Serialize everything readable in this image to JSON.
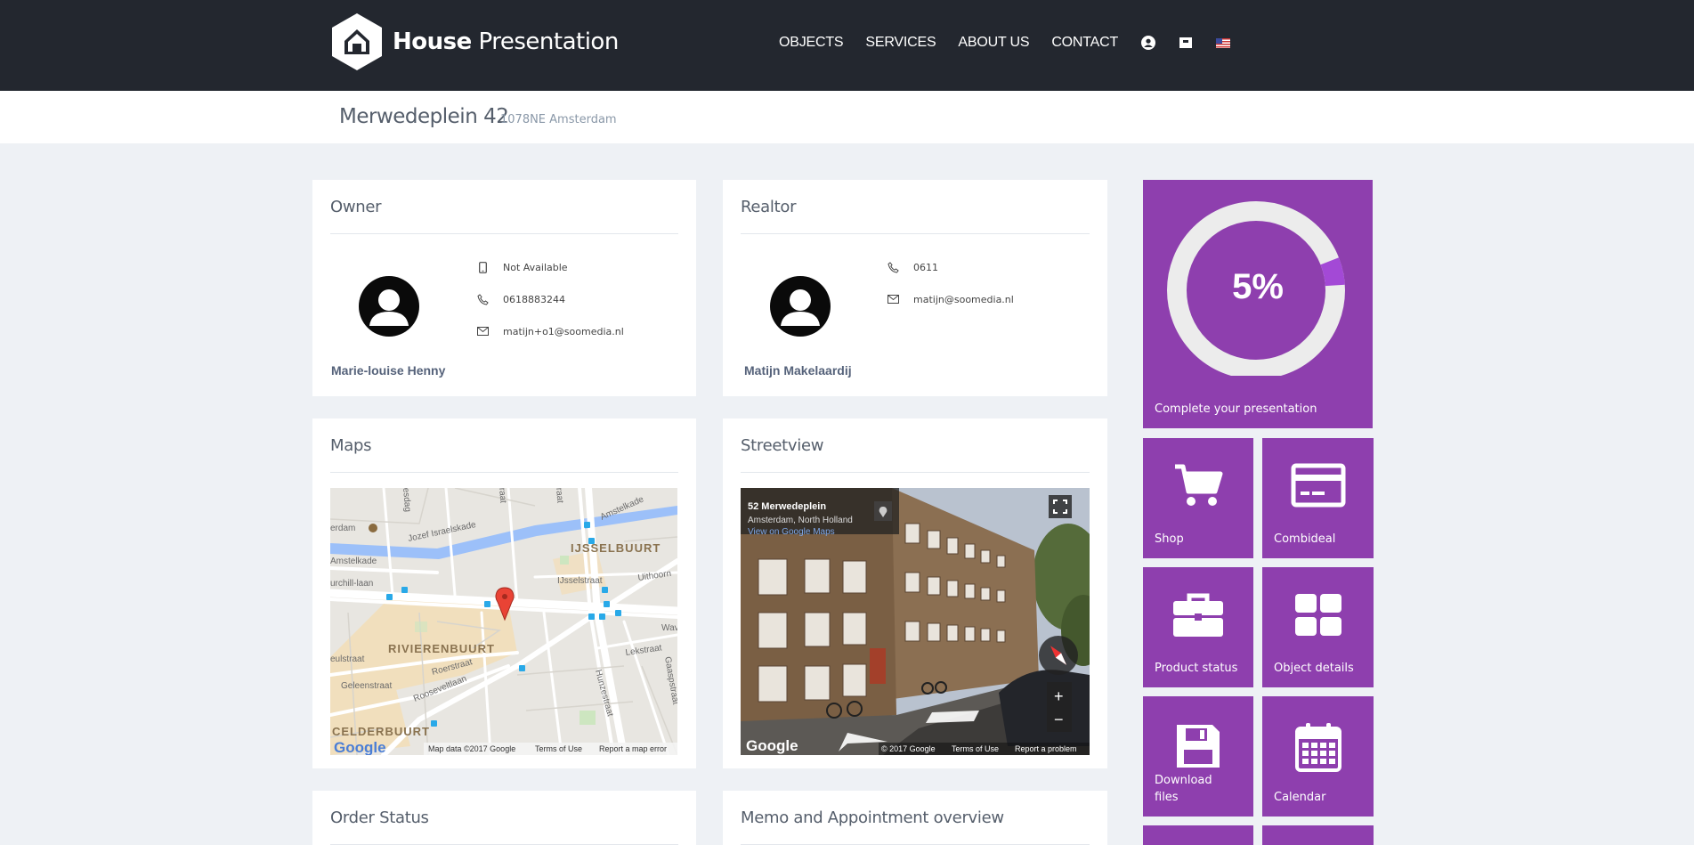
{
  "brand": {
    "bold": "House",
    "light": "Presentation"
  },
  "nav": {
    "items": [
      "OBJECTS",
      "SERVICES",
      "ABOUT US",
      "CONTACT"
    ]
  },
  "address": {
    "street": "Merwedeplein 42",
    "city": "1078NE Amsterdam"
  },
  "owner": {
    "title": "Owner",
    "name": "Marie-louise Henny",
    "mobile": "Not Available",
    "phone": "0618883244",
    "email": "matijn+o1@soomedia.nl"
  },
  "realtor": {
    "title": "Realtor",
    "name": "Matijn Makelaardij",
    "phone": "0611",
    "email": "matijn@soomedia.nl"
  },
  "maps": {
    "title": "Maps",
    "labels": {
      "ijsselbuurt": "IJSSELBUURT",
      "rivierenbuurt": "RIVIERENBUURT",
      "amstelkade_top": "Amstelkade",
      "amstelkade_left": "Amstelkade",
      "jozef": "Jozef Israelskade",
      "ijsselstraat": "IJsselstraat",
      "churchill": "urchill-laan",
      "rooseveltlaan": "Rooseveltlaan",
      "geleenstraat": "Geleenstraat",
      "roerstraat": "Roerstraat",
      "hunzestraat": "Hunzestraat",
      "lekstraat": "Lekstraat",
      "gaasp": "Gaaspstraat",
      "uithoorn": "Uithoorn",
      "waver": "Wav",
      "eulstraat": "eulstraat",
      "erdam": "erdam",
      "celderbuurt": "CELDERBUURT",
      "esdag": "esdag",
      "raat1": "raat",
      "raat2": "raat"
    },
    "google": "Google",
    "attribution": "Map data ©2017 Google",
    "terms": "Terms of Use",
    "report": "Report a map error"
  },
  "streetview": {
    "title": "Streetview",
    "place": "52 Merwedeplein",
    "region": "Amsterdam, North Holland",
    "link": "View on Google Maps",
    "google": "Google",
    "copyright": "© 2017 Google",
    "terms": "Terms of Use",
    "report": "Report a problem",
    "plus": "+",
    "minus": "−"
  },
  "bottom_cards": {
    "order": "Order Status",
    "memo": "Memo and Appointment overview"
  },
  "progress": {
    "percent_label": "5%",
    "fraction": 0.05,
    "label": "Complete your presentation"
  },
  "tiles": {
    "shop": "Shop",
    "combideal": "Combideal",
    "product_status": "Product status",
    "object_details": "Object details",
    "download_1": "Download",
    "download_2": "files",
    "calendar": "Calendar"
  },
  "colors": {
    "header": "#23272f",
    "tile": "#8e3fae",
    "progress_fill": "#a349d6",
    "background": "#eef1f5"
  }
}
